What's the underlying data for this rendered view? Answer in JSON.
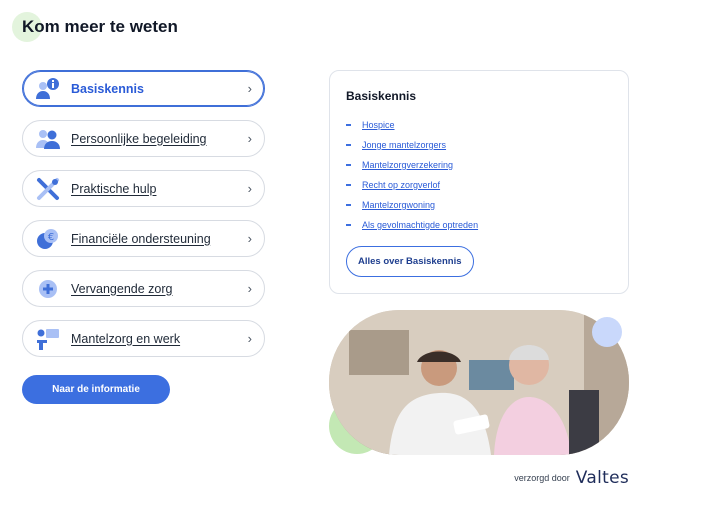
{
  "page": {
    "title": "Kom meer te weten"
  },
  "menu": {
    "items": [
      {
        "label": "Basiskennis",
        "icon": "info-person-icon",
        "active": true
      },
      {
        "label": "Persoonlijke begeleiding",
        "icon": "people-icon",
        "active": false
      },
      {
        "label": "Praktische hulp",
        "icon": "tools-icon",
        "active": false
      },
      {
        "label": "Financiële ondersteuning",
        "icon": "euro-coins-icon",
        "active": false
      },
      {
        "label": "Vervangende zorg",
        "icon": "plus-circle-icon",
        "active": false
      },
      {
        "label": "Mantelzorg en werk",
        "icon": "person-at-desk-icon",
        "active": false
      }
    ],
    "chevron": "›"
  },
  "primary_button": {
    "label": "Naar de informatie"
  },
  "card": {
    "title": "Basiskennis",
    "links": [
      "Hospice",
      "Jonge mantelzorgers",
      "Mantelzorgverzekering",
      "Recht op zorgverlof",
      "Mantelzorgwoning",
      "Als gevolmachtigde optreden"
    ],
    "button_label": "Alles over Basiskennis"
  },
  "credit": {
    "text": "verzorgd door",
    "brand": "Valtes"
  },
  "colors": {
    "accent": "#3c6fe0",
    "icon": "#3f6fd8",
    "icon_light": "#a9c0f5"
  }
}
